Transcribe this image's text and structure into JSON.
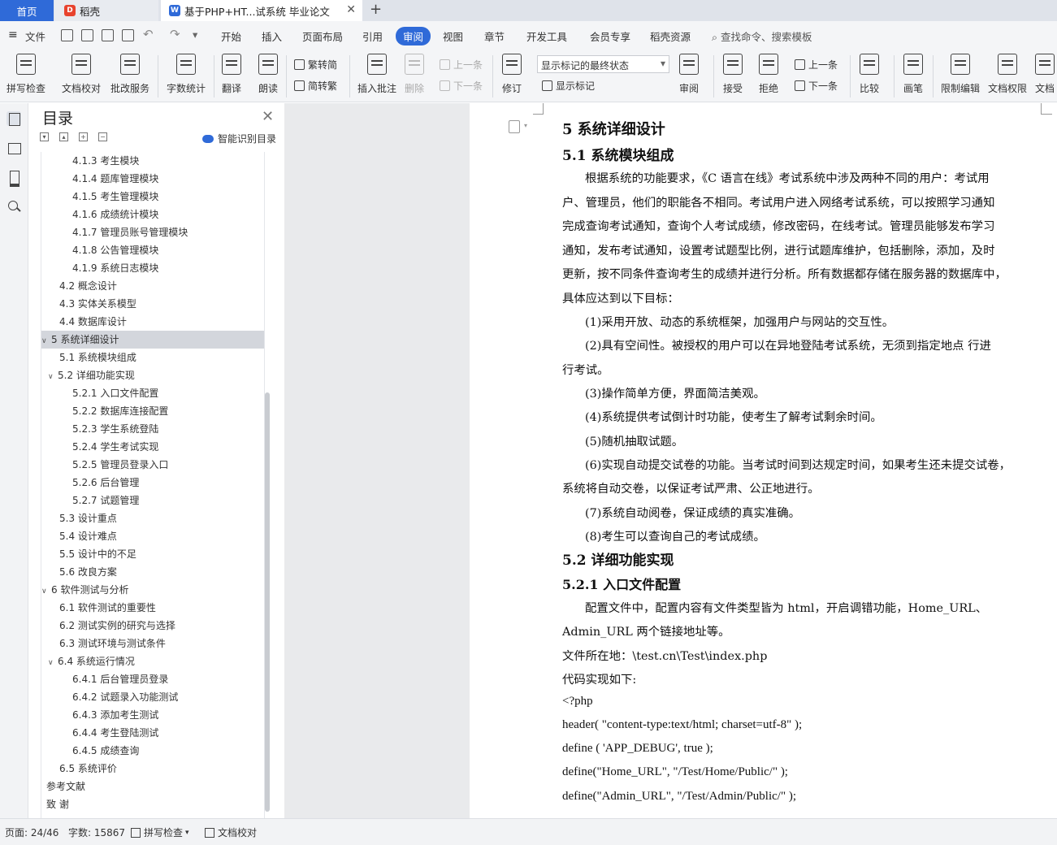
{
  "tabs": {
    "home": "首页",
    "daoke": "稻壳",
    "doc": "基于PHP+HT...试系统 毕业论文",
    "add": "+",
    "close": "✕"
  },
  "menu": {
    "file": "文件",
    "items": [
      "开始",
      "插入",
      "页面布局",
      "引用",
      "审阅",
      "视图",
      "章节",
      "开发工具",
      "会员专享",
      "稻壳资源"
    ],
    "search": "查找命令、搜索模板"
  },
  "ribbon": {
    "spellcheck": "拼写检查",
    "doccheck": "文档校对",
    "batch": "批改服务",
    "wordcount": "字数统计",
    "translate": "翻译",
    "read": "朗读",
    "to_trad": "繁转简",
    "to_simp": "简转繁",
    "insert_comment": "插入批注",
    "delete": "删除",
    "prev_comment": "上一条",
    "next_comment": "下一条",
    "revise": "修订",
    "markup_state": "显示标记的最终状态",
    "show_markup": "显示标记",
    "review": "审阅",
    "accept": "接受",
    "reject": "拒绝",
    "prev": "上一条",
    "next": "下一条",
    "compare": "比较",
    "pen": "画笔",
    "restrict": "限制编辑",
    "rights": "文档权限",
    "doc_more": "文档"
  },
  "toc": {
    "title": "目录",
    "smart": "智能识别目录",
    "items": [
      {
        "text": "4.1.3 考生模块",
        "level": 3
      },
      {
        "text": "4.1.4 题库管理模块",
        "level": 3
      },
      {
        "text": "4.1.5 考生管理模块",
        "level": 3
      },
      {
        "text": "4.1.6 成绩统计模块",
        "level": 3
      },
      {
        "text": "4.1.7 管理员账号管理模块",
        "level": 3
      },
      {
        "text": "4.1.8 公告管理模块",
        "level": 3
      },
      {
        "text": "4.1.9 系统日志模块",
        "level": 3
      },
      {
        "text": "4.2 概念设计",
        "level": 2
      },
      {
        "text": "4.3 实体关系模型",
        "level": 2
      },
      {
        "text": "4.4 数据库设计",
        "level": 2
      },
      {
        "text": "5 系统详细设计",
        "level": 1,
        "expanded": true,
        "selected": true
      },
      {
        "text": "5.1 系统模块组成",
        "level": 2
      },
      {
        "text": "5.2 详细功能实现",
        "level": 2,
        "expanded": true
      },
      {
        "text": "5.2.1 入口文件配置",
        "level": 3
      },
      {
        "text": "5.2.2 数据库连接配置",
        "level": 3
      },
      {
        "text": "5.2.3 学生系统登陆",
        "level": 3
      },
      {
        "text": "5.2.4 学生考试实现",
        "level": 3
      },
      {
        "text": "5.2.5 管理员登录入口",
        "level": 3
      },
      {
        "text": "5.2.6 后台管理",
        "level": 3
      },
      {
        "text": "5.2.7 试题管理",
        "level": 3
      },
      {
        "text": "5.3 设计重点",
        "level": 2
      },
      {
        "text": "5.4 设计难点",
        "level": 2
      },
      {
        "text": "5.5 设计中的不足",
        "level": 2
      },
      {
        "text": "5.6 改良方案",
        "level": 2
      },
      {
        "text": "6 软件测试与分析",
        "level": 1,
        "expanded": true
      },
      {
        "text": "6.1 软件测试的重要性",
        "level": 2
      },
      {
        "text": "6.2 测试实例的研究与选择",
        "level": 2
      },
      {
        "text": "6.3 测试环境与测试条件",
        "level": 2
      },
      {
        "text": "6.4 系统运行情况",
        "level": 2,
        "expanded": true
      },
      {
        "text": "6.4.1 后台管理员登录",
        "level": 3
      },
      {
        "text": "6.4.2 试题录入功能测试",
        "level": 3
      },
      {
        "text": "6.4.3 添加考生测试",
        "level": 3
      },
      {
        "text": "6.4.4 考生登陆测试",
        "level": 3
      },
      {
        "text": "6.4.5 成绩查询",
        "level": 3
      },
      {
        "text": "6.5 系统评价",
        "level": 2
      },
      {
        "text": "参考文献",
        "level": 1
      },
      {
        "text": "致 谢",
        "level": 1
      }
    ]
  },
  "doc": {
    "h1": "5 系统详细设计",
    "h2a": "5.1 系统模块组成",
    "p1": [
      "根据系统的功能要求，《C 语言在线》考试系统中涉及两种不同的用户：考试用",
      "户、管理员，他们的职能各不相同。考试用户进入网络考试系统，可以按照学习通知",
      "完成查询考试通知，查询个人考试成绩，修改密码，在线考试。管理员能够发布学习",
      "通知，发布考试通知，设置考试题型比例，进行试题库维护，包括删除，添加，及时",
      "更新，按不同条件查询考生的成绩并进行分析。所有数据都存储在服务器的数据库中，",
      "具体应达到以下目标："
    ],
    "goals": [
      "(1)采用开放、动态的系统框架，加强用户与网站的交互性。",
      "(2)具有空间性。被授权的用户可以在异地登陆考试系统，无须到指定地点  行进",
      "行考试。",
      "(3)操作简单方便，界面简洁美观。",
      "(4)系统提供考试倒计时功能，使考生了解考试剩余时间。",
      "(5)随机抽取试题。",
      "(6)实现自动提交试卷的功能。当考试时间到达规定时间，如果考生还未提交试卷，",
      "系统将自动交卷，以保证考试严肃、公正地进行。",
      "(7)系统自动阅卷，保证成绩的真实准确。",
      "(8)考生可以查询自己的考试成绩。"
    ],
    "h2b": "5.2 详细功能实现",
    "h3": "5.2.1 入口文件配置",
    "p2a": "配置文件中，配置内容有文件类型皆为 html，开启调错功能，Home_URL、",
    "p2b": "Admin_URL 两个链接地址等。",
    "p3": "文件所在地：\\test.cn\\Test\\index.php",
    "p4": "代码实现如下:",
    "code": [
      "<?php",
      "header( \"content-type:text/html; charset=utf-8\" );",
      "define ( 'APP_DEBUG', true );",
      "define(\"Home_URL\", \"/Test/Home/Public/\" );",
      "define(\"Admin_URL\", \"/Test/Admin/Public/\" );"
    ]
  },
  "status": {
    "page": "页面: 24/46",
    "words": "字数: 15867",
    "spell": "拼写检查",
    "proof": "文档校对"
  }
}
